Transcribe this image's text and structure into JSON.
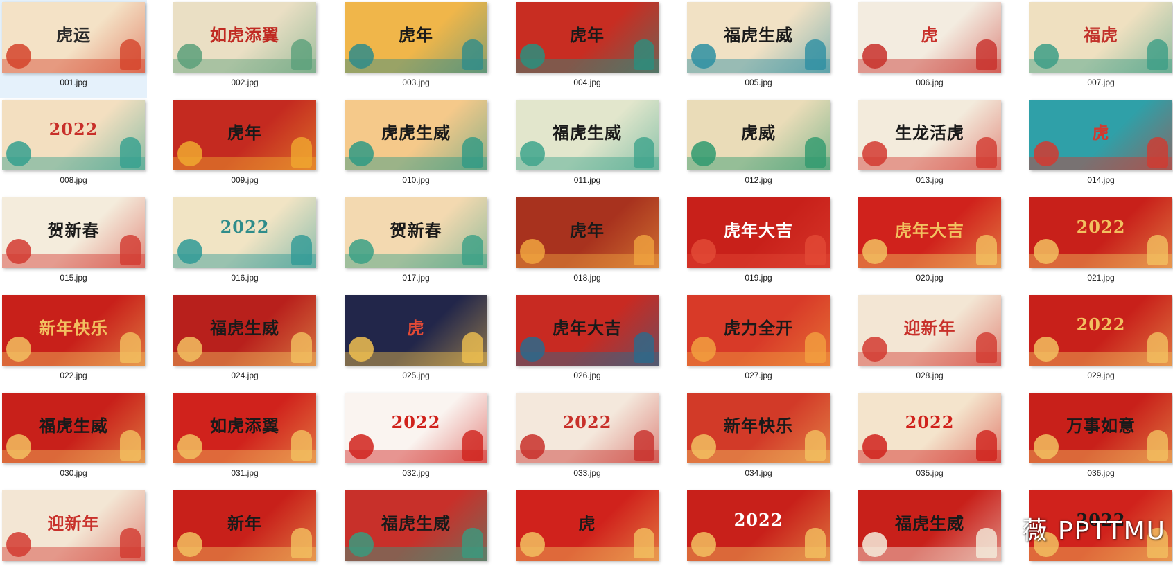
{
  "files": [
    {
      "name": "001.jpg",
      "title": "虎运",
      "bg": "#f4e2c6",
      "accent": "#d4432a",
      "ink": "#2b2b2b",
      "selected": true
    },
    {
      "name": "002.jpg",
      "title": "如虎添翼",
      "bg": "#eadfc4",
      "accent": "#5aa07a",
      "ink": "#c02a22"
    },
    {
      "name": "003.jpg",
      "title": "虎年",
      "bg": "#f0b64a",
      "accent": "#2f8c8a",
      "ink": "#1a1a1a"
    },
    {
      "name": "004.jpg",
      "title": "虎年",
      "bg": "#c82d22",
      "accent": "#2a8f7e",
      "ink": "#1a1a1a"
    },
    {
      "name": "005.jpg",
      "title": "福虎生威",
      "bg": "#f1e1c4",
      "accent": "#2d8fa2",
      "ink": "#1a1a1a"
    },
    {
      "name": "006.jpg",
      "title": "虎",
      "bg": "#f3ece0",
      "accent": "#c8302a",
      "ink": "#c8302a"
    },
    {
      "name": "007.jpg",
      "title": "福虎",
      "bg": "#efe0c0",
      "accent": "#3c9e86",
      "ink": "#c2322b"
    },
    {
      "name": "008.jpg",
      "title": "2022",
      "bg": "#f3dfc0",
      "accent": "#35a08e",
      "ink": "#c8302a"
    },
    {
      "name": "009.jpg",
      "title": "虎年",
      "bg": "#c42a20",
      "accent": "#f0a830",
      "ink": "#1a1a1a"
    },
    {
      "name": "010.jpg",
      "title": "虎虎生威",
      "bg": "#f5c98a",
      "accent": "#2f9a84",
      "ink": "#1a1a1a"
    },
    {
      "name": "011.jpg",
      "title": "福虎生威",
      "bg": "#e2e6cc",
      "accent": "#3ea48c",
      "ink": "#1a1a1a"
    },
    {
      "name": "012.jpg",
      "title": "虎威",
      "bg": "#eadcb8",
      "accent": "#2f9a6e",
      "ink": "#1a1a1a"
    },
    {
      "name": "013.jpg",
      "title": "生龙活虎",
      "bg": "#f3ebdc",
      "accent": "#d23a30",
      "ink": "#1a1a1a"
    },
    {
      "name": "014.jpg",
      "title": "虎",
      "bg": "#2fa0a8",
      "accent": "#d23a30",
      "ink": "#d23a30"
    },
    {
      "name": "015.jpg",
      "title": "贺新春",
      "bg": "#f4ecdc",
      "accent": "#d23a30",
      "ink": "#1a1a1a"
    },
    {
      "name": "016.jpg",
      "title": "2022",
      "bg": "#f1e4c4",
      "accent": "#2f9a96",
      "ink": "#2f8c8a"
    },
    {
      "name": "017.jpg",
      "title": "贺新春",
      "bg": "#f3d9b0",
      "accent": "#3aa086",
      "ink": "#1a1a1a"
    },
    {
      "name": "018.jpg",
      "title": "虎年",
      "bg": "#a8321e",
      "accent": "#f0a440",
      "ink": "#1a1a1a"
    },
    {
      "name": "019.jpg",
      "title": "虎年大吉",
      "bg": "#c8201a",
      "accent": "#e24a36",
      "ink": "#ffffff"
    },
    {
      "name": "020.jpg",
      "title": "虎年大吉",
      "bg": "#d0221c",
      "accent": "#f2c060",
      "ink": "#f2c060"
    },
    {
      "name": "021.jpg",
      "title": "2022",
      "bg": "#c8201a",
      "accent": "#f2c060",
      "ink": "#f2c060"
    },
    {
      "name": "022.jpg",
      "title": "新年快乐",
      "bg": "#c8201a",
      "accent": "#f2c060",
      "ink": "#f2c060"
    },
    {
      "name": "024.jpg",
      "title": "福虎生威",
      "bg": "#b8201c",
      "accent": "#f2c060",
      "ink": "#1a1a1a"
    },
    {
      "name": "025.jpg",
      "title": "虎",
      "bg": "#22264a",
      "accent": "#f0c050",
      "ink": "#e24a36"
    },
    {
      "name": "026.jpg",
      "title": "虎年大吉",
      "bg": "#c82a22",
      "accent": "#2a6a8c",
      "ink": "#1a1a1a"
    },
    {
      "name": "027.jpg",
      "title": "虎力全开",
      "bg": "#d83a28",
      "accent": "#f2a040",
      "ink": "#1a1a1a"
    },
    {
      "name": "028.jpg",
      "title": "迎新年",
      "bg": "#f3e6d4",
      "accent": "#d23a30",
      "ink": "#c8302a"
    },
    {
      "name": "029.jpg",
      "title": "2022",
      "bg": "#c8201a",
      "accent": "#f2c060",
      "ink": "#f2c060"
    },
    {
      "name": "030.jpg",
      "title": "福虎生威",
      "bg": "#c8201a",
      "accent": "#f2c060",
      "ink": "#1a1a1a"
    },
    {
      "name": "031.jpg",
      "title": "如虎添翼",
      "bg": "#d0221c",
      "accent": "#f2c060",
      "ink": "#1a1a1a"
    },
    {
      "name": "032.jpg",
      "title": "2022",
      "bg": "#faf4f0",
      "accent": "#d0221c",
      "ink": "#d0221c"
    },
    {
      "name": "033.jpg",
      "title": "2022",
      "bg": "#f4e8dc",
      "accent": "#c8302a",
      "ink": "#c8302a"
    },
    {
      "name": "034.jpg",
      "title": "新年快乐",
      "bg": "#d23a28",
      "accent": "#f2c060",
      "ink": "#1a1a1a"
    },
    {
      "name": "035.jpg",
      "title": "2022",
      "bg": "#f4e4cc",
      "accent": "#d0221c",
      "ink": "#d0221c"
    },
    {
      "name": "036.jpg",
      "title": "万事如意",
      "bg": "#c8201a",
      "accent": "#f2c060",
      "ink": "#1a1a1a"
    },
    {
      "name": "",
      "title": "迎新年",
      "bg": "#f3e6d4",
      "accent": "#d23a30",
      "ink": "#c8302a"
    },
    {
      "name": "",
      "title": "新年",
      "bg": "#c8201a",
      "accent": "#f2c060",
      "ink": "#1a1a1a"
    },
    {
      "name": "",
      "title": "福虎生威",
      "bg": "#c8302a",
      "accent": "#3a9a7e",
      "ink": "#1a1a1a"
    },
    {
      "name": "",
      "title": "虎",
      "bg": "#d0221c",
      "accent": "#f2c060",
      "ink": "#1a1a1a"
    },
    {
      "name": "",
      "title": "2022",
      "bg": "#c8201a",
      "accent": "#f2c060",
      "ink": "#ffffff"
    },
    {
      "name": "",
      "title": "福虎生威",
      "bg": "#c8201a",
      "accent": "#f4ecdc",
      "ink": "#1a1a1a"
    },
    {
      "name": "",
      "title": "2022",
      "bg": "#d0221c",
      "accent": "#f2c060",
      "ink": "#1a1a1a"
    }
  ],
  "watermark": "薇 PPTTMU"
}
